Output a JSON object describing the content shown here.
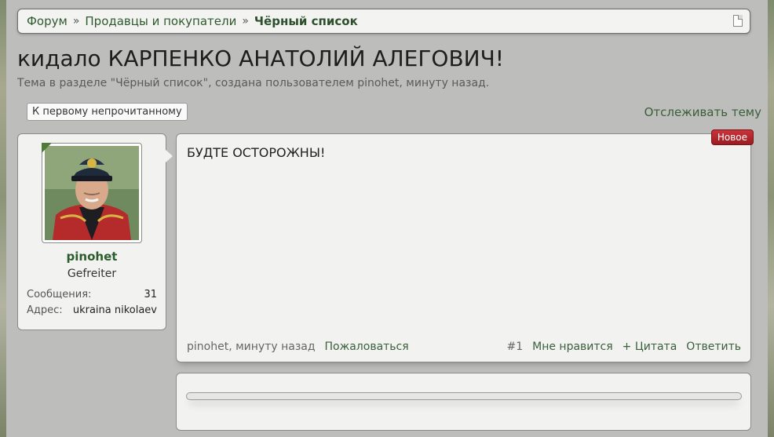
{
  "breadcrumb": {
    "items": [
      "Форум",
      "Продавцы и покупатели",
      "Чёрный список"
    ],
    "separator": "»"
  },
  "thread": {
    "title": "кидало КАРПЕНКО АНАТОЛИЙ АЛЕГОВИЧ!",
    "description": "Тема в разделе \"Чёрный список\", создана пользователем pinohet, минуту назад.",
    "first_unread_label": "К первому непрочитанному",
    "watch_label": "Отслеживать тему"
  },
  "user": {
    "username": "pinohet",
    "title": "Gefreiter",
    "stats": [
      {
        "label": "Сообщения:",
        "value": "31"
      },
      {
        "label": "Адрес:",
        "value": "ukraina nikolaev"
      }
    ]
  },
  "post": {
    "badge": "Новое",
    "message": "БУДТЕ ОСТОРОЖНЫ!",
    "meta": "pinohet, минуту назад",
    "report_label": "Пожаловаться",
    "number": "#1",
    "like_label": "Мне нравится",
    "quote_label": "+ Цитата",
    "reply_label": "Ответить"
  },
  "colors": {
    "link": "#3a5f3a",
    "username": "#2b5c2b",
    "badge": "#b2262c"
  }
}
